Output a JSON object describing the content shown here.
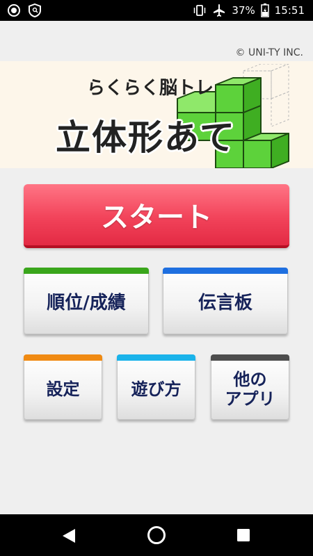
{
  "status_bar": {
    "battery": "37%",
    "time": "15:51"
  },
  "copyright": "© UNI-TY INC.",
  "banner": {
    "subtitle": "らくらく脳トレ",
    "title": "立体形あて"
  },
  "buttons": {
    "start": "スタート",
    "ranking": "順位/成績",
    "board": "伝言板",
    "settings": "設定",
    "howto": "遊び方",
    "other_line1": "他の",
    "other_line2": "アプリ"
  },
  "colors": {
    "start_red": "#f2435a",
    "ranking_bar": "#3aa61c",
    "board_bar": "#1e6fe0",
    "settings_bar": "#f08a12",
    "howto_bar": "#1ab3ea",
    "other_bar": "#4d4d4d",
    "block_green": "#5dd23b"
  }
}
